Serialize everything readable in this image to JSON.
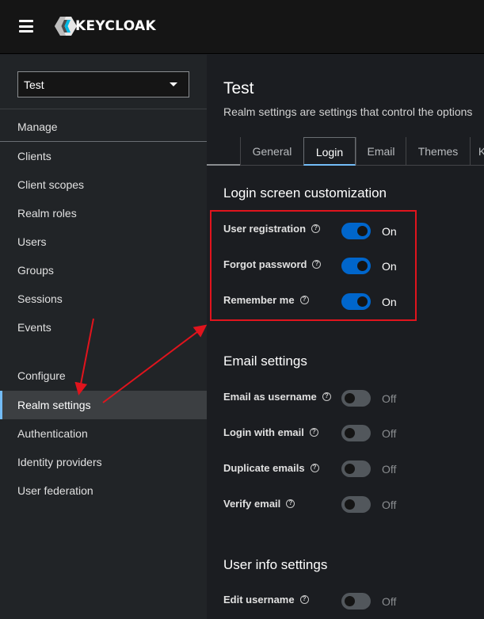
{
  "header": {
    "logo_text": "KEYCLOAK"
  },
  "sidebar": {
    "realm_selector": {
      "value": "Test"
    },
    "manage_heading": "Manage",
    "manage_items": [
      {
        "label": "Clients"
      },
      {
        "label": "Client scopes"
      },
      {
        "label": "Realm roles"
      },
      {
        "label": "Users"
      },
      {
        "label": "Groups"
      },
      {
        "label": "Sessions"
      },
      {
        "label": "Events"
      }
    ],
    "configure_heading": "Configure",
    "configure_items": [
      {
        "label": "Realm settings",
        "active": true
      },
      {
        "label": "Authentication"
      },
      {
        "label": "Identity providers"
      },
      {
        "label": "User federation"
      }
    ]
  },
  "main": {
    "title": "Test",
    "description": "Realm settings are settings that control the options",
    "tabs": [
      {
        "label": "General"
      },
      {
        "label": "Login",
        "active": true
      },
      {
        "label": "Email"
      },
      {
        "label": "Themes"
      },
      {
        "label": "K"
      }
    ],
    "sections": [
      {
        "heading": "Login screen customization",
        "settings": [
          {
            "label": "User registration",
            "state": "On"
          },
          {
            "label": "Forgot password",
            "state": "On"
          },
          {
            "label": "Remember me",
            "state": "On"
          }
        ]
      },
      {
        "heading": "Email settings",
        "settings": [
          {
            "label": "Email as username",
            "state": "Off"
          },
          {
            "label": "Login with email",
            "state": "Off"
          },
          {
            "label": "Duplicate emails",
            "state": "Off"
          },
          {
            "label": "Verify email",
            "state": "Off"
          }
        ]
      },
      {
        "heading": "User info settings",
        "settings": [
          {
            "label": "Edit username",
            "state": "Off"
          }
        ]
      }
    ]
  },
  "colors": {
    "toggle_on": "#0066cc",
    "toggle_off": "#52575c",
    "annotation_red": "#e0141d",
    "active_tab_accent": "#73bcf7"
  },
  "icons": [
    "hamburger-icon",
    "keycloak-logo-icon",
    "caret-down-icon",
    "help-icon"
  ]
}
